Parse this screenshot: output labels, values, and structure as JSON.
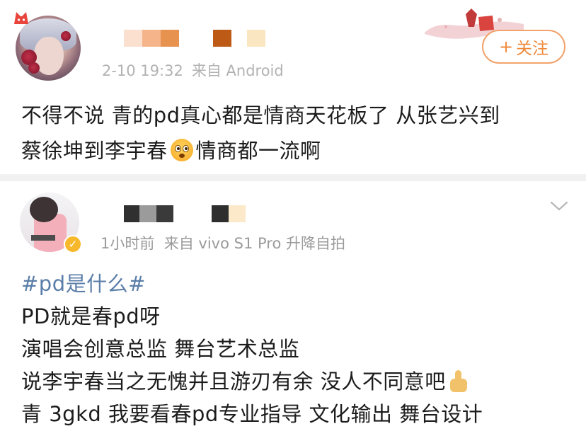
{
  "colors": {
    "follow_accent": "#ef8a3c",
    "topic_link": "#5b7ea9",
    "meta_gray": "#b2b2b2",
    "verified_badge": "#f7b82b"
  },
  "post1": {
    "meta": {
      "time": "2-10 19:32",
      "source": "来自 Android"
    },
    "follow_button": {
      "icon": "plus-icon",
      "label": "关注"
    },
    "body": {
      "line1": "不得不说  青的pd真心都是情商天花板了  从张艺兴到",
      "line2_before": "蔡徐坤到李宇春",
      "emoji": "flushed-face-emoji",
      "line2_after": "情商都一流啊"
    }
  },
  "post2": {
    "meta": {
      "time": "1小时前",
      "source": "来自 vivo S1 Pro 升降自拍"
    },
    "verified_icon": "verified-v-icon",
    "more_icon": "chevron-down-icon",
    "body": {
      "topic": "#pd是什么#",
      "line2": "PD就是春pd呀",
      "line3": "演唱会创意总监  舞台艺术总监",
      "line4": "说李宇春当之无愧并且游刃有余 没人不同意吧",
      "line4_emoji": "thumbs-up-emoji",
      "line5": "青 3gkd 我要看春pd专业指导 文化输出 舞台设计"
    }
  }
}
